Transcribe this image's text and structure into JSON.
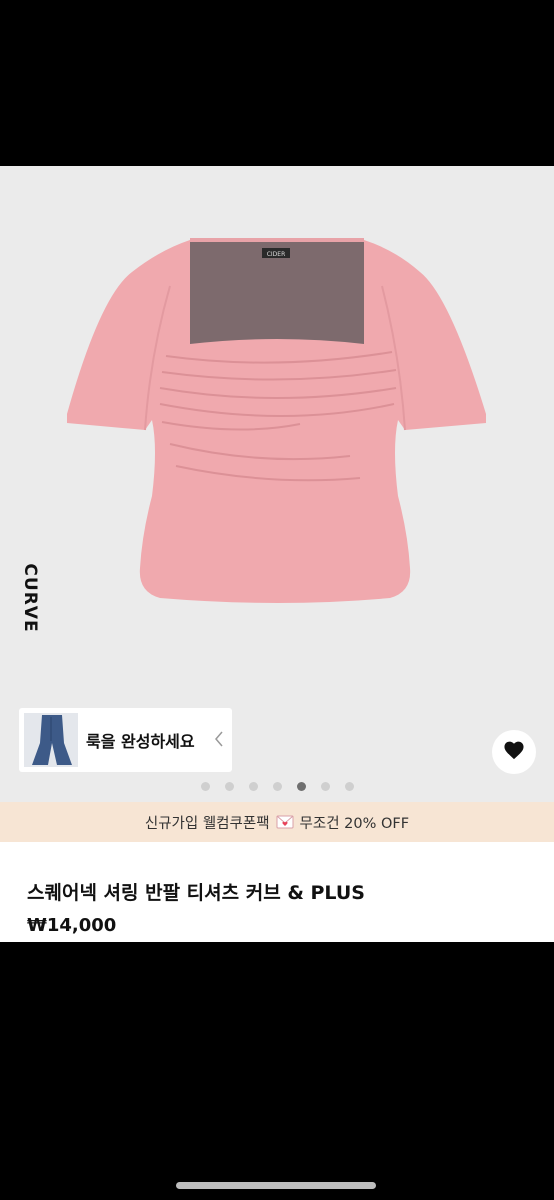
{
  "gallery": {
    "side_text": "CURVE",
    "garment_tag": "CIDER",
    "complete_look_label": "룩을 완성하세요",
    "dots": {
      "count": 7,
      "active_index": 4
    }
  },
  "promo": {
    "text_before": "신규가입 웰컴쿠폰팩",
    "text_after": "무조건 20% OFF"
  },
  "product": {
    "title": "스퀘어넥 셔링 반팔 티셔츠 커브 & PLUS",
    "price": "₩14,000"
  },
  "colors": {
    "gallery_bg": "#ebebeb",
    "garment_pink": "#f0a9ae",
    "promo_bg": "#f7e5d4",
    "active_dot": "#6f6f6f"
  },
  "icons": {
    "heart": "heart-icon",
    "chevron": "chevron-left-icon",
    "envelope": "love-letter-icon"
  }
}
